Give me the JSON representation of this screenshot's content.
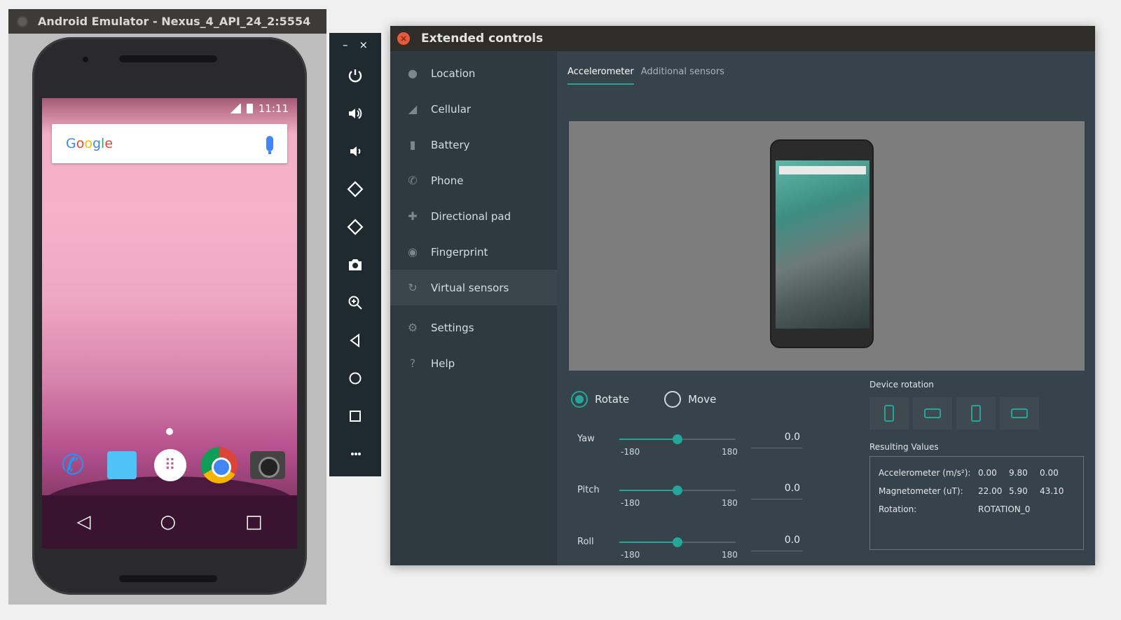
{
  "emulator": {
    "title": "Android Emulator - Nexus_4_API_24_2:5554",
    "status_time": "11:11",
    "search_logo": "Google",
    "nav_back": "◁",
    "nav_home": "○",
    "nav_recents": "□"
  },
  "toolbar": {
    "minimize": "–",
    "close": "×"
  },
  "extended": {
    "title": "Extended controls",
    "nav": [
      {
        "label": "Location",
        "icon": "location-pin-icon"
      },
      {
        "label": "Cellular",
        "icon": "cellular-signal-icon"
      },
      {
        "label": "Battery",
        "icon": "battery-icon"
      },
      {
        "label": "Phone",
        "icon": "phone-icon"
      },
      {
        "label": "Directional pad",
        "icon": "dpad-icon"
      },
      {
        "label": "Fingerprint",
        "icon": "fingerprint-icon"
      },
      {
        "label": "Virtual sensors",
        "icon": "rotation-icon"
      },
      {
        "label": "Settings",
        "icon": "gear-icon"
      },
      {
        "label": "Help",
        "icon": "help-icon"
      }
    ],
    "active_nav": "Virtual sensors",
    "tabs": [
      "Accelerometer",
      "Additional sensors"
    ],
    "active_tab": "Accelerometer",
    "mode": {
      "rotate": "Rotate",
      "move": "Move",
      "selected": "Rotate"
    },
    "sliders": [
      {
        "label": "Yaw",
        "min": "-180",
        "max": "180",
        "value": "0.0",
        "fraction": 0.5
      },
      {
        "label": "Pitch",
        "min": "-180",
        "max": "180",
        "value": "0.0",
        "fraction": 0.5
      },
      {
        "label": "Roll",
        "min": "-180",
        "max": "180",
        "value": "0.0",
        "fraction": 0.5
      }
    ],
    "device_rotation_label": "Device rotation",
    "resulting_values_label": "Resulting Values",
    "results": {
      "accelerometer": {
        "label": "Accelerometer (m/s²):",
        "v1": "0.00",
        "v2": "9.80",
        "v3": "0.00"
      },
      "magnetometer": {
        "label": "Magnetometer (uT):",
        "v1": "22.00",
        "v2": "5.90",
        "v3": "43.10"
      },
      "rotation": {
        "label": "Rotation:",
        "value": "ROTATION_0"
      }
    },
    "accent_color": "#26a69a"
  }
}
